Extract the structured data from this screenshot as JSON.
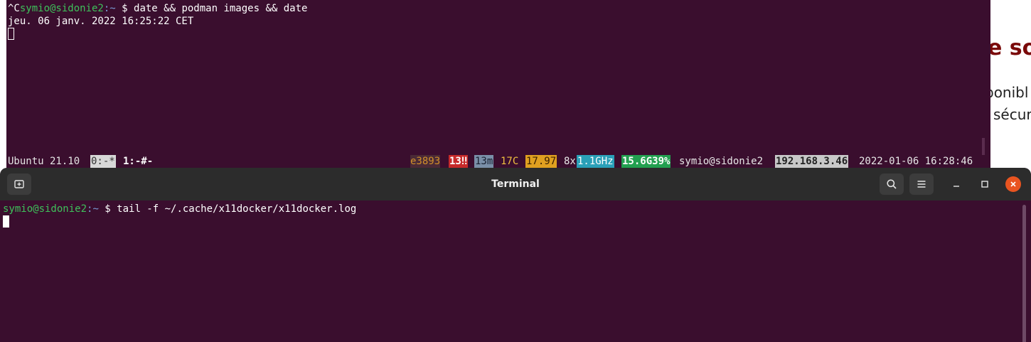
{
  "background_page": {
    "heading": "e so",
    "text_line_1": "ponibl",
    "text_line_2": "sécur"
  },
  "top_terminal": {
    "line1": {
      "prefix": "^C",
      "user_host": "symio@sidonie2",
      "path": ":~",
      "command": " $ date && podman images && date"
    },
    "line2": "jeu. 06 janv. 2022 16:25:22 CET"
  },
  "statusbar": {
    "os": "Ubuntu 21.10",
    "window0": "0:-*",
    "window1": "1:-#-",
    "e_value": "e3893",
    "warnings": "13‼",
    "uptime": "13m",
    "temperature": "17C",
    "load": "17.97",
    "cpu_count": "8x",
    "cpu_freq": "1.1GHz",
    "memory": "15.6G39%",
    "user_host": "symio@sidonie2",
    "ip": "192.168.3.46",
    "datetime": "2022-01-06 16:28:46"
  },
  "terminal_window": {
    "title": "Terminal",
    "prompt_user_host": "symio@sidonie2",
    "prompt_path": ":~",
    "command": " $ tail -f ~/.cache/x11docker/x11docker.log"
  },
  "colors": {
    "terminal_bg": "#3a0e2e",
    "prompt_green": "#3ec05a",
    "close_button": "#e95420"
  },
  "icons": {
    "new_tab": "new-tab-icon",
    "search": "search-icon",
    "menu": "hamburger-menu-icon",
    "minimize": "minimize-icon",
    "maximize": "maximize-icon",
    "close": "close-icon"
  }
}
